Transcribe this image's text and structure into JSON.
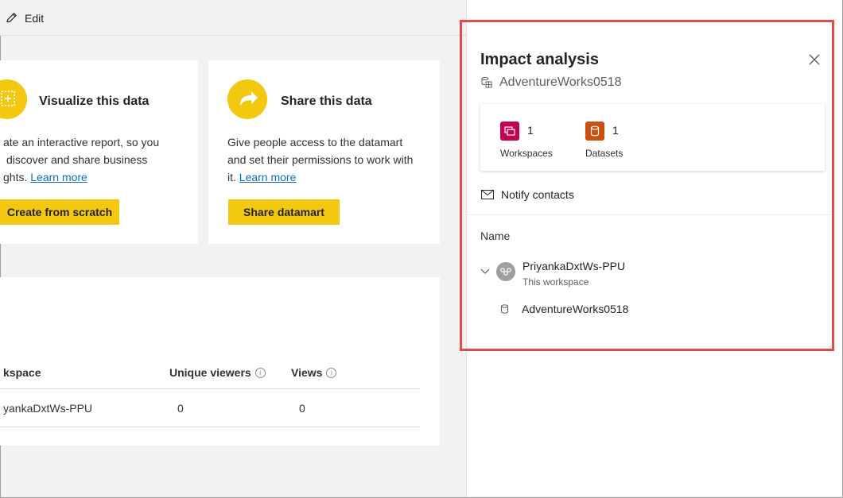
{
  "toolbar": {
    "edit_label": "Edit"
  },
  "cards": [
    {
      "title": "Visualize this data",
      "desc_lines": [
        "ate an interactive report, so you",
        "discover and share business",
        "ghts."
      ],
      "link": "Learn more",
      "button": "Create from scratch"
    },
    {
      "title": "Share this data",
      "desc_lines": [
        "Give people access to the datamart",
        "and set their permissions to work with",
        "it."
      ],
      "link": "Learn more",
      "button": "Share datamart"
    }
  ],
  "table": {
    "headers": [
      "kspace",
      "Unique viewers",
      "Views"
    ],
    "info_glyph": "i",
    "rows": [
      [
        "yankaDxtWs-PPU",
        "0",
        "0"
      ]
    ]
  },
  "panel": {
    "title": "Impact analysis",
    "item_name": "AdventureWorks0518",
    "summary": [
      {
        "count": "1",
        "label": "Workspaces",
        "color": "#c30052"
      },
      {
        "count": "1",
        "label": "Datasets",
        "color": "#ca5010"
      }
    ],
    "notify_label": "Notify contacts",
    "list_header": "Name",
    "workspace": {
      "name": "PriyankaDxtWs-PPU",
      "subtitle": "This workspace"
    },
    "dataset": {
      "name": "AdventureWorks0518"
    }
  },
  "colors": {
    "accent_yellow": "#f2c811",
    "highlight_red": "#e24c4c",
    "link_blue": "#0f6cbd"
  }
}
